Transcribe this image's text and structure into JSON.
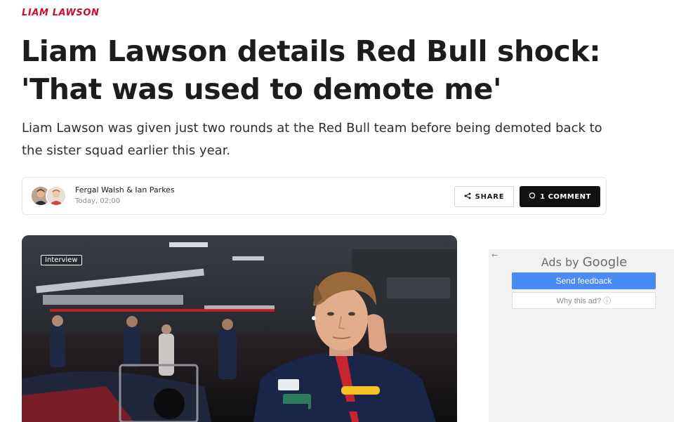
{
  "article": {
    "category": "LIAM LAWSON",
    "headline": "Liam Lawson details Red Bull shock: 'That was used to demote me'",
    "standfirst": "Liam Lawson was given just two rounds at the Red Bull team before being demoted back to the sister squad earlier this year."
  },
  "byline": {
    "authors": "Fergal Walsh & Ian Parkes",
    "published": "Today, 02:00",
    "share_label": "SHARE",
    "comment_label": "1 COMMENT"
  },
  "hero": {
    "tag": "Interview"
  },
  "ad": {
    "back_icon": "←",
    "ads_by": "Ads by",
    "google": "Google",
    "feedback_label": "Send feedback",
    "why_label": "Why this ad? ⓘ"
  },
  "colors": {
    "accent": "#c8102e",
    "button_dark": "#111111",
    "ad_blue": "#4a8af4"
  }
}
